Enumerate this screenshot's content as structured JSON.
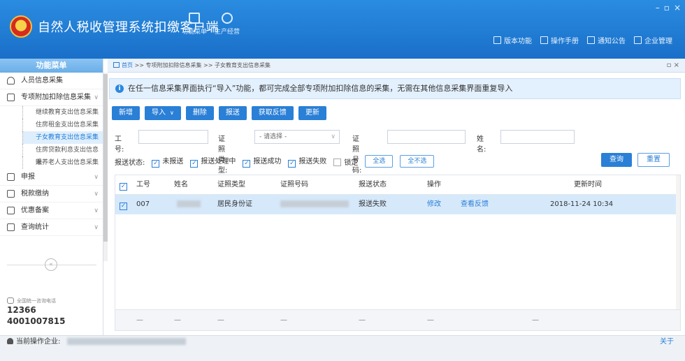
{
  "app": {
    "title": "自然人税收管理系统扣缴客户端",
    "toolbar_top": [
      {
        "label": "功能菜单",
        "icon": "menu-icon"
      },
      {
        "label": "生产经营",
        "icon": "coins-icon"
      }
    ],
    "right_links": [
      {
        "label": "版本功能",
        "icon": "doc-icon"
      },
      {
        "label": "操作手册",
        "icon": "manual-icon"
      },
      {
        "label": "通知公告",
        "icon": "mail-icon"
      },
      {
        "label": "企业管理",
        "icon": "building-icon"
      }
    ],
    "window_controls": {
      "minimize": "–",
      "maximize": "▫",
      "close": "×"
    }
  },
  "sidebar": {
    "header": "功能菜单",
    "items": [
      {
        "label": "人员信息采集",
        "icon": "person-icon"
      },
      {
        "label": "专项附加扣除信息采集",
        "icon": "grid-icon",
        "expanded": true
      }
    ],
    "sub_items": [
      {
        "label": "继续教育支出信息采集"
      },
      {
        "label": "住房租金支出信息采集"
      },
      {
        "label": "子女教育支出信息采集",
        "active": true
      },
      {
        "label": "住房贷款利息支出信息采"
      },
      {
        "label": "赡养老人支出信息采集"
      }
    ],
    "more_items": [
      {
        "label": "申报",
        "icon": "grid-icon"
      },
      {
        "label": "税款缴纳",
        "icon": "grid-icon"
      },
      {
        "label": "优惠备案",
        "icon": "square-icon"
      },
      {
        "label": "查询统计",
        "icon": "grid-icon"
      }
    ],
    "collapse_label": "«",
    "hotline_label": "全国统一咨询电话",
    "hotline_numbers": [
      "12366",
      "4001007815"
    ]
  },
  "breadcrumb": {
    "home": "首页",
    "sep": ">>",
    "path": [
      "专项附加扣除信息采集",
      "子女教育支出信息采集"
    ],
    "tab_controls": "▫ ×"
  },
  "banner": {
    "text": "在任一信息采集界面执行“导入”功能，都可完成全部专项附加扣除信息的采集，无需在其他信息采集界面重复导入"
  },
  "toolbar": {
    "buttons": [
      "新增",
      "导入",
      "删除",
      "报送",
      "获取反馈",
      "更新"
    ]
  },
  "filters": {
    "job_no_label": "工号:",
    "id_type_label": "证照类型:",
    "id_type_value": "- 请选择 -",
    "id_no_label": "证照号码:",
    "name_label": "姓名:",
    "status_label": "报送状态:",
    "statuses": [
      {
        "label": "未报送",
        "checked": true
      },
      {
        "label": "报送处理中",
        "checked": true
      },
      {
        "label": "报送成功",
        "checked": true
      },
      {
        "label": "报送失败",
        "checked": true
      },
      {
        "label": "锁定",
        "checked": false
      }
    ],
    "select_all": "全选",
    "select_none": "全不选",
    "query": "查询",
    "reset": "重置"
  },
  "table": {
    "columns": [
      "工号",
      "姓名",
      "证照类型",
      "证照号码",
      "报送状态",
      "操作",
      "更新时间"
    ],
    "rows": [
      {
        "job_no": "007",
        "name": "",
        "id_type": "居民身份证",
        "id_no": "",
        "status": "报送失败",
        "actions": [
          "修改",
          "查看反馈"
        ],
        "updated": "2018-11-24 10:34"
      }
    ],
    "footer_dash": "—"
  },
  "statusbar": {
    "label": "当前操作企业:",
    "about": "关于"
  },
  "colors": {
    "primary": "#2a7fd6",
    "titlebar": "#1a6fc9",
    "selected_row": "#d6e9fb"
  }
}
